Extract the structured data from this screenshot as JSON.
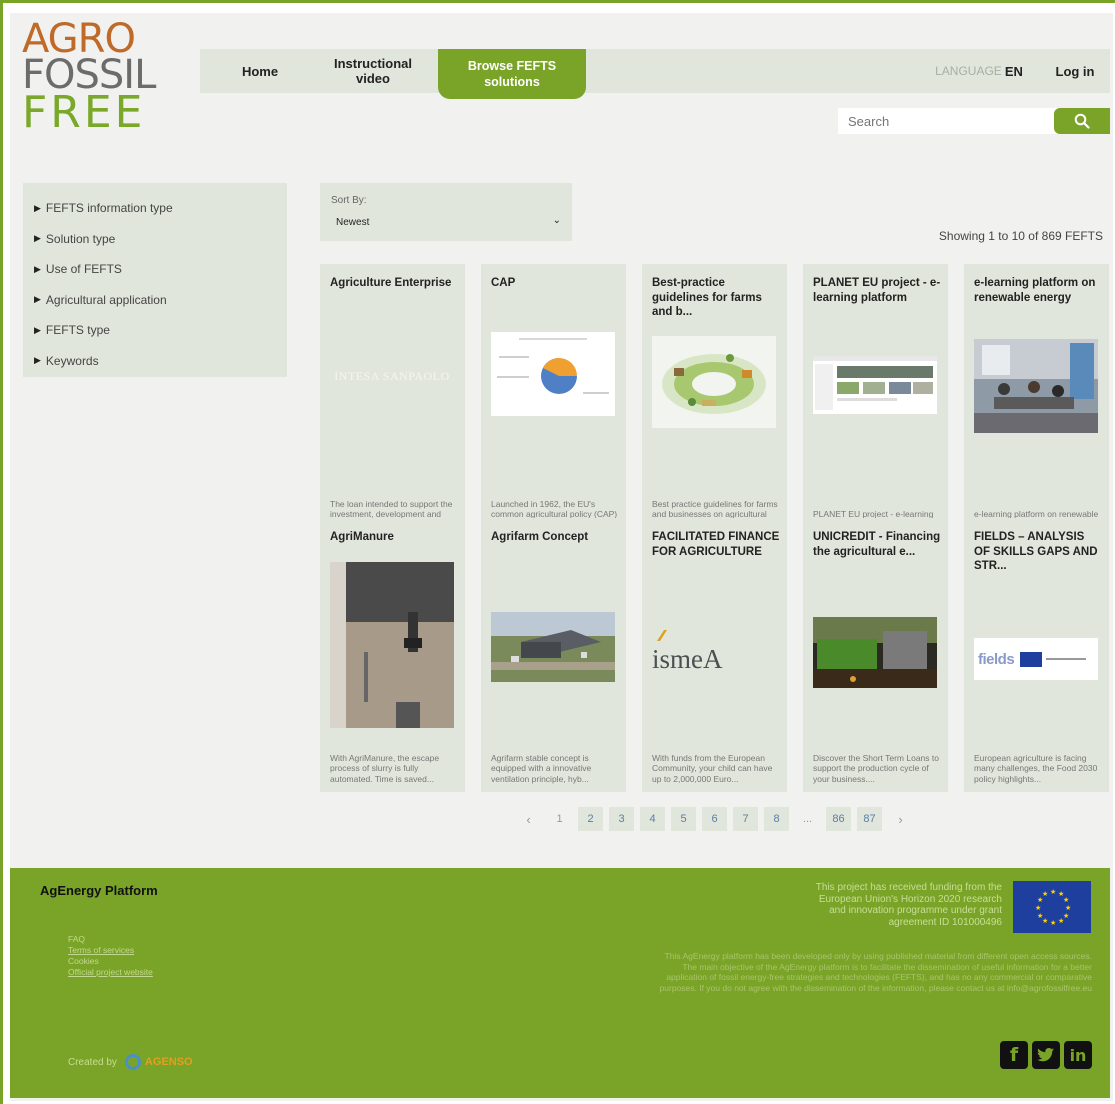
{
  "logo": {
    "line1": "AGRO",
    "line2": "FOSSIL",
    "line3": "FREE"
  },
  "nav": {
    "home": "Home",
    "video_line1": "Instructional",
    "video_line2": "video",
    "browse_line1": "Browse FEFTS",
    "browse_line2": "solutions",
    "language_label": "LANGUAGE",
    "language_code": "EN",
    "login": "Log in"
  },
  "search": {
    "placeholder": "Search"
  },
  "filters": [
    "FEFTS information type",
    "Solution type",
    "Use of FEFTS",
    "Agricultural application",
    "FEFTS type",
    "Keywords"
  ],
  "sort": {
    "label": "Sort By:",
    "value": "Newest"
  },
  "showing": "Showing 1 to 10 of 869 FEFTS",
  "cards": [
    {
      "title": "Agriculture Enterprise",
      "desc": "The loan intended to support the investment, development and rebalancing program...",
      "image": "intesa-sanpaolo-logo",
      "logo_text": "INTESA SANPAOLO"
    },
    {
      "title": "CAP",
      "desc": "Launched in 1962, the EU's common agricultural policy (CAP) is a partnership bet...",
      "image": "pie-chart-image"
    },
    {
      "title": "Best-practice guidelines for farms and b...",
      "desc": "Best practice guidelines for farms and businesses on agricultural waste manageme...",
      "image": "circular-farm-illustration"
    },
    {
      "title": "PLANET EU project - e-learning platform",
      "desc": "PLANET EU project - e-learning platform",
      "image": "website-screenshot"
    },
    {
      "title": "e-learning platform on renewable energy",
      "desc": "e-learning platform on renewable energy",
      "image": "meeting-room-photo"
    },
    {
      "title": "AgriManure",
      "desc": "With AgriManure, the escape process of slurry is fully automated. Time is saved...",
      "image": "manure-device-photo"
    },
    {
      "title": "Agrifarm Concept",
      "desc": "Agrifarm stable concept is equipped with a innovative ventilation principle, hyb...",
      "image": "farm-aerial-photo"
    },
    {
      "title": "FACILITATED FINANCE FOR AGRICULTURE",
      "desc": "With funds from the European Community, your child can have up to 2,000,000 Euro...",
      "image": "ismea-logo",
      "logo_text": "ismeA"
    },
    {
      "title": "UNICREDIT - Financing the agricultural e...",
      "desc": "Discover the Short Term Loans to support the production cycle of your business....",
      "image": "seedling-photo"
    },
    {
      "title": "FIELDS – ANALYSIS OF SKILLS GAPS AND STR...",
      "desc": "European agriculture is facing many challenges, the Food 2030 policy highlights...",
      "image": "fields-eu-logo",
      "logo_text": "fields"
    }
  ],
  "pagination": {
    "prev": "‹",
    "pages": [
      "1",
      "2",
      "3",
      "4",
      "5",
      "6",
      "7",
      "8"
    ],
    "dots": "...",
    "tail": [
      "86",
      "87"
    ],
    "next": "›",
    "current": "1"
  },
  "footer": {
    "title": "AgEnergy Platform",
    "links": [
      "FAQ",
      "Terms of services",
      "Cookies",
      "Official project website"
    ],
    "funding": "This project has received funding from the European Union's Horizon 2020 research and innovation programme under grant agreement ID 101000496",
    "disclaimer": "This AgEnergy platform has been developed only by using published material from different open access sources. The main objective of the AgEnergy platform is to facilitate the dissemination of useful information for a better application of fossil energy-free strategies and technologies (FEFTS), and has no any commercial or comparative purposes. If you do not agree with the dissemination of the information, please contact us at info@agrofossilfree.eu",
    "created_by": "Created by",
    "creator": "AGENSO"
  },
  "colors": {
    "accent": "#7aa428",
    "panel": "#e1e6dc",
    "page_bg": "#f1f2f0"
  }
}
